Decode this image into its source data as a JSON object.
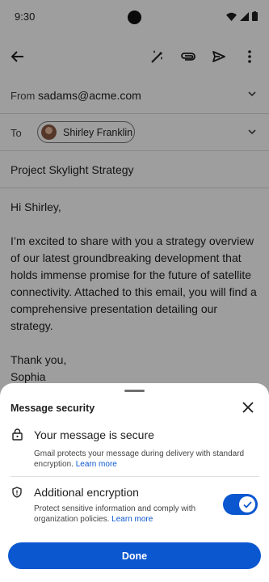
{
  "status_bar": {
    "time": "9:30"
  },
  "toolbar": {
    "icons": [
      "back-arrow-icon",
      "magic-pen-icon",
      "attachment-icon",
      "send-icon",
      "more-vert-icon"
    ]
  },
  "compose": {
    "from_label": "From",
    "from_value": "sadams@acme.com",
    "to_label": "To",
    "to_chip": "Shirley Franklin",
    "subject": "Project Skylight Strategy",
    "body": {
      "greeting": "Hi Shirley,",
      "paragraph": "I’m excited to share with you a strategy overview of our latest groundbreaking development that holds immense promise for the future of satellite connectivity. Attached to this email, you will find a comprehensive presentation detailing our strategy.",
      "signoff": "Thank you,",
      "signature": "Sophia"
    }
  },
  "sheet": {
    "title": "Message security",
    "secure": {
      "title": "Your message is secure",
      "description": "Gmail protects your message during delivery with standard encryption.",
      "link": "Learn more"
    },
    "encryption": {
      "title": "Additional encryption",
      "description": "Protect sensitive information and comply with organization policies.",
      "link": "Learn more",
      "enabled": true
    },
    "done_label": "Done"
  },
  "colors": {
    "accent": "#0b57d0",
    "scrim": "rgba(0,0,0,0.38)"
  }
}
